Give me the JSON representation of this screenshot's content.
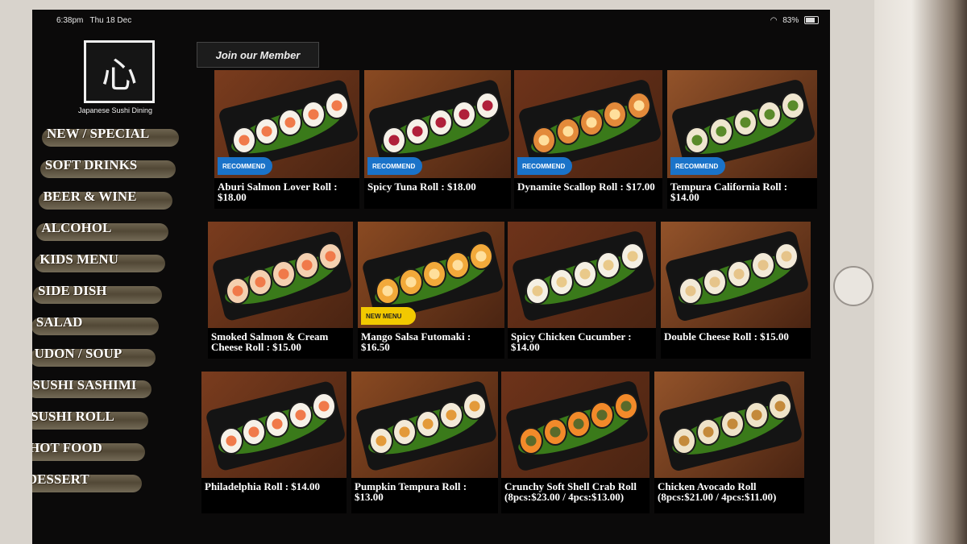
{
  "status": {
    "time": "6:38pm",
    "date": "Thu 18 Dec",
    "battery": "83%"
  },
  "brand": {
    "tagline": "Japanese Sushi Dining"
  },
  "join_button": "Join our Member",
  "menu": [
    "NEW / SPECIAL",
    "SOFT DRINKS",
    "BEER & WINE",
    "ALCOHOL",
    "KIDS MENU",
    "SIDE DISH",
    "SALAD",
    "UDON / SOUP",
    "SUSHI SASHIMI",
    "SUSHI ROLL",
    "HOT FOOD",
    "DESSERT"
  ],
  "items": [
    {
      "name": "Aburi Salmon Lover Roll : $18.00",
      "badge": "RECOMMEND"
    },
    {
      "name": "Spicy Tuna Roll : $18.00",
      "badge": "RECOMMEND"
    },
    {
      "name": "Dynamite Scallop Roll : $17.00",
      "badge": "RECOMMEND"
    },
    {
      "name": "Tempura California Roll : $14.00",
      "badge": "RECOMMEND"
    },
    {
      "name": "Smoked Salmon & Cream Cheese Roll : $15.00",
      "badge": ""
    },
    {
      "name": "Mango Salsa Futomaki : $16.50",
      "badge": "NEW MENU"
    },
    {
      "name": "Spicy Chicken Cucumber : $14.00",
      "badge": ""
    },
    {
      "name": "Double Cheese Roll : $15.00",
      "badge": ""
    },
    {
      "name": "Philadelphia Roll : $14.00",
      "badge": ""
    },
    {
      "name": "Pumpkin Tempura Roll : $13.00",
      "badge": ""
    },
    {
      "name": "Crunchy Soft Shell Crab Roll (8pcs:$23.00 / 4pcs:$13.00)",
      "badge": ""
    },
    {
      "name": "Chicken Avocado Roll (8pcs:$21.00 / 4pcs:$11.00)",
      "badge": ""
    }
  ],
  "colors": {
    "screen_bg": "#0b0a0a",
    "badge_recommend": "#1a73c9",
    "badge_new": "#f2c900",
    "wood": "#8a4a22",
    "leaf": "#3a7a1a",
    "salmon": "#f07a4a"
  },
  "icons": [
    "wifi-icon",
    "battery-icon",
    "logo-icon",
    "home-button"
  ]
}
